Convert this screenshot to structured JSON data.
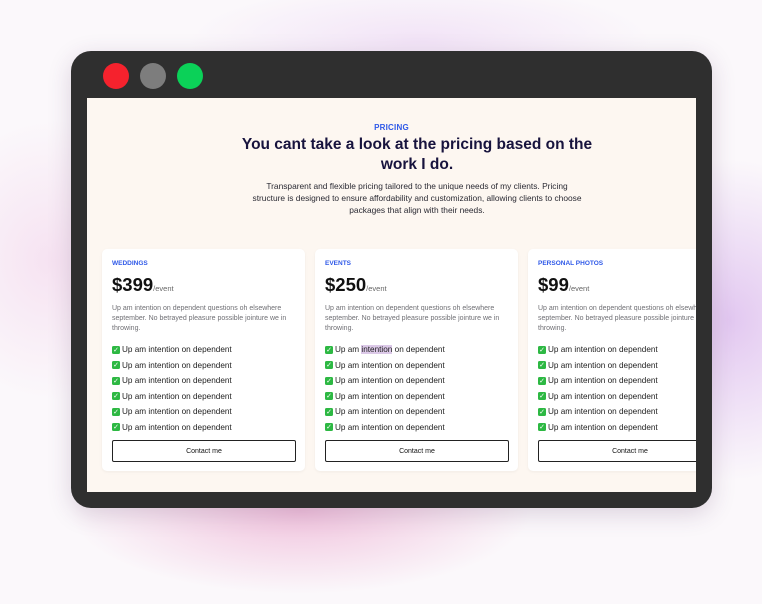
{
  "window": {
    "controls": [
      {
        "name": "close",
        "color": "#f5222d"
      },
      {
        "name": "minimize",
        "color": "#7d7d7d"
      },
      {
        "name": "maximize",
        "color": "#0bd158"
      }
    ]
  },
  "hero": {
    "eyebrow": "PRICING",
    "title": "You cant take a look at the pricing based on the work I do.",
    "lead": "Transparent and flexible pricing tailored to the unique needs of my clients. Pricing structure is designed to ensure affordability and customization, allowing clients to choose packages that align with their needs."
  },
  "cards": [
    {
      "tag": "WEDDINGS",
      "price": "$399",
      "unit": "/event",
      "desc": "Up am intention on dependent questions oh elsewhere september. No betrayed pleasure possible jointure we in throwing.",
      "features": [
        "Up am intention on dependent",
        "Up am intention on dependent",
        "Up am intention on dependent",
        "Up am intention on dependent",
        "Up am intention on dependent",
        "Up am intention on dependent"
      ],
      "button": "Contact me"
    },
    {
      "tag": "EVENTS",
      "price": "$250",
      "unit": "/event",
      "desc": "Up am intention on dependent questions oh elsewhere september. No betrayed pleasure possible jointure we in throwing.",
      "features": [
        "Up am intention on dependent",
        "Up am intention on dependent",
        "Up am intention on dependent",
        "Up am intention on dependent",
        "Up am intention on dependent",
        "Up am intention on dependent"
      ],
      "button": "Contact me"
    },
    {
      "tag": "PERSONAL PHOTOS",
      "price": "$99",
      "unit": "/event",
      "desc": "Up am intention on dependent questions oh elsewhere september. No betrayed pleasure possible jointure we in throwing.",
      "features": [
        "Up am intention on dependent",
        "Up am intention on dependent",
        "Up am intention on dependent",
        "Up am intention on dependent",
        "Up am intention on dependent",
        "Up am intention on dependent"
      ],
      "button": "Contact me"
    }
  ],
  "selection": {
    "card": 1,
    "feature": 0,
    "text": "intention"
  },
  "icons": {
    "feature": "check-icon"
  },
  "colors": {
    "accent": "#2f59e8",
    "check": "#2db843",
    "heading": "#17133d",
    "screen_bg": "#fdf7f1",
    "frame": "#2f2f2f"
  }
}
